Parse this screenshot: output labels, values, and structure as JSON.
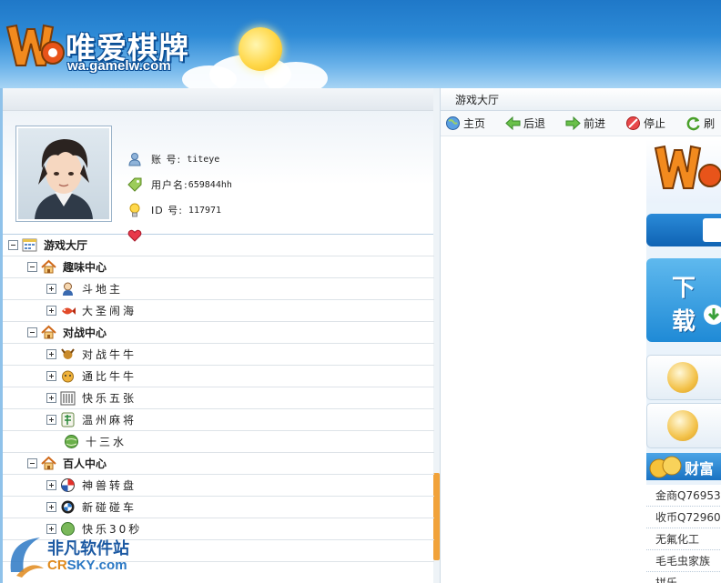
{
  "header": {
    "brand_cn": "唯爱棋牌",
    "brand_url": "wa.gamelw.com"
  },
  "profile": {
    "account_label": "账  号:",
    "account_value": "titeye",
    "username_label": "用户名:",
    "username_value": "659844hh",
    "id_label": "ID  号:",
    "id_value": "117971"
  },
  "tree": {
    "root": "游戏大厅",
    "groups": [
      {
        "label": "趣味中心",
        "items": [
          "斗地主",
          "大圣闹海"
        ]
      },
      {
        "label": "对战中心",
        "items": [
          "对战牛牛",
          "通比牛牛",
          "快乐五张",
          "温州麻将",
          "十三水"
        ]
      },
      {
        "label": "百人中心",
        "items": [
          "神兽转盘",
          "新碰碰车",
          "快乐30秒"
        ]
      }
    ]
  },
  "right": {
    "tab_label": "游戏大厅",
    "nav": {
      "home": "主页",
      "back": "后退",
      "forward": "前进",
      "stop": "停止",
      "refresh": "刷"
    },
    "web": {
      "download": "下载",
      "wealth": "财富",
      "list": [
        "金商Q76953",
        "收币Q72960",
        "无氟化工",
        "毛毛虫家族",
        "拼乐"
      ]
    }
  },
  "watermark": {
    "cn": "非凡软件站",
    "en_prefix": "CR",
    "en_mid": "SKY",
    "en_suffix": ".com"
  },
  "colors": {
    "header_blue": "#2d8ad6",
    "accent_orange": "#f1a23a",
    "link_blue": "#1f78c8"
  }
}
